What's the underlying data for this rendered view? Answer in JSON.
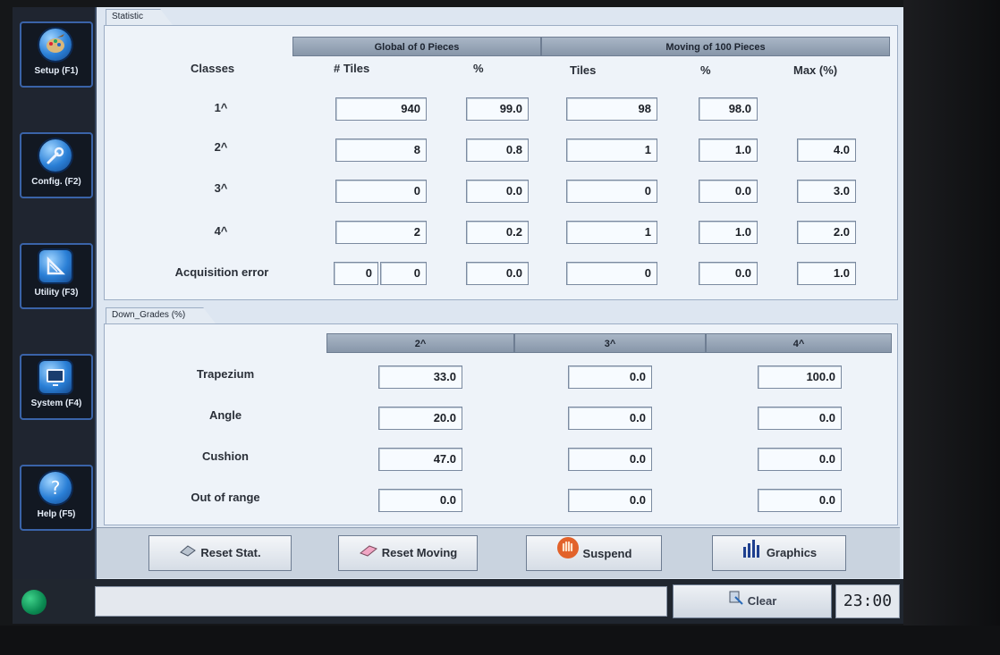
{
  "sidebar": {
    "buttons": [
      {
        "label": "Setup (F1)",
        "icon": "palette-icon"
      },
      {
        "label": "Config. (F2)",
        "icon": "wrench-icon"
      },
      {
        "label": "Utility (F3)",
        "icon": "set-square-icon"
      },
      {
        "label": "System (F4)",
        "icon": "monitor-icon"
      },
      {
        "label": "Help (F5)",
        "icon": "question-icon"
      }
    ]
  },
  "statistic": {
    "tab_label": "Statistic",
    "group_global": "Global of 0 Pieces",
    "group_moving": "Moving of 100 Pieces",
    "col_classes": "Classes",
    "col_tiles_global": "# Tiles",
    "col_pct_global": "%",
    "col_tiles_moving": "Tiles",
    "col_pct_moving": "%",
    "col_max": "Max (%)",
    "rows": [
      {
        "label": "1^",
        "tiles": "940",
        "pct": "99.0",
        "mtiles": "98",
        "mpct": "98.0",
        "max": ""
      },
      {
        "label": "2^",
        "tiles": "8",
        "pct": "0.8",
        "mtiles": "1",
        "mpct": "1.0",
        "max": "4.0"
      },
      {
        "label": "3^",
        "tiles": "0",
        "pct": "0.0",
        "mtiles": "0",
        "mpct": "0.0",
        "max": "3.0"
      },
      {
        "label": "4^",
        "tiles": "2",
        "pct": "0.2",
        "mtiles": "1",
        "mpct": "1.0",
        "max": "2.0"
      },
      {
        "label": "Acquisition error",
        "tiles_a": "0",
        "tiles_b": "0",
        "pct": "0.0",
        "mtiles": "0",
        "mpct": "0.0",
        "max": "1.0"
      }
    ]
  },
  "downgrades": {
    "tab_label": "Down_Grades (%)",
    "cols": [
      "2^",
      "3^",
      "4^"
    ],
    "rows": [
      {
        "label": "Trapezium",
        "v": [
          "33.0",
          "0.0",
          "100.0"
        ]
      },
      {
        "label": "Angle",
        "v": [
          "20.0",
          "0.0",
          "0.0"
        ]
      },
      {
        "label": "Cushion",
        "v": [
          "47.0",
          "0.0",
          "0.0"
        ]
      },
      {
        "label": "Out of range",
        "v": [
          "0.0",
          "0.0",
          "0.0"
        ]
      }
    ]
  },
  "toolbar": {
    "reset_stat": "Reset Stat.",
    "reset_moving": "Reset Moving",
    "suspend": "Suspend",
    "graphics": "Graphics"
  },
  "status": {
    "clear_label": "Clear",
    "time": "23:00",
    "led_color": "#0b8a52"
  }
}
